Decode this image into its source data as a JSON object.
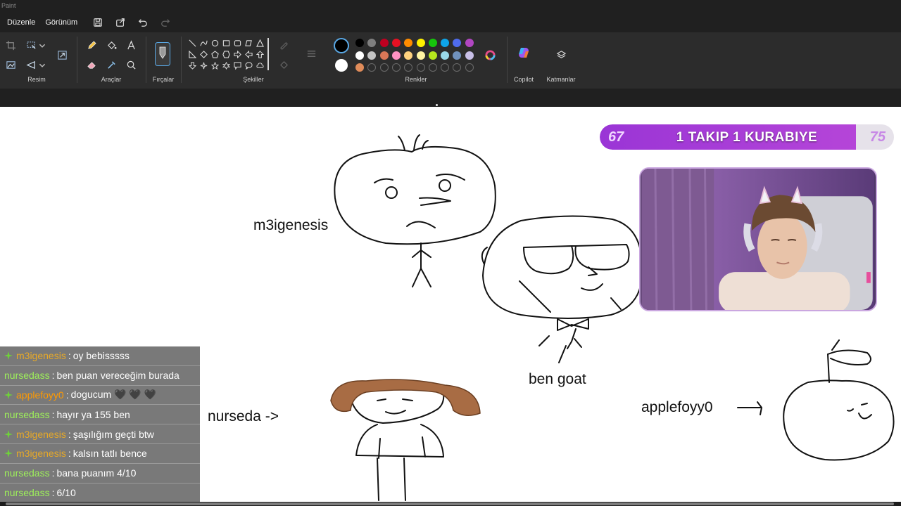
{
  "window": {
    "title": "Paint"
  },
  "menu": {
    "edit": "Düzenle",
    "view": "Görünüm"
  },
  "ribbon": {
    "groups": {
      "image": "Resim",
      "tools": "Araçlar",
      "brushes": "Fırçalar",
      "shapes": "Şekiller",
      "colors": "Renkler",
      "copilot": "Copilot",
      "layers": "Katmanlar"
    },
    "palette": {
      "row1": [
        "#000000",
        "#7f7f7f",
        "#c00020",
        "#e81123",
        "#ff8c00",
        "#fff100",
        "#16c60c",
        "#0ea5e9",
        "#4f6bed",
        "#b146c2"
      ],
      "row2": [
        "#ffffff",
        "#c3c3c3",
        "#d97757",
        "#ff92c2",
        "#ffd27f",
        "#fff4a3",
        "#b5e61d",
        "#99d9ea",
        "#7092be",
        "#c8bfe7"
      ],
      "row3": [
        "#e08c5a"
      ],
      "primary": "#000000",
      "secondary": "#ffffff"
    }
  },
  "goal": {
    "start": "67",
    "title": "1 TAKIP 1 KURABIYE",
    "end": "75",
    "progress": 0.87
  },
  "canvas": {
    "labels": {
      "m3igenesis": "m3igenesis",
      "ben_goat": "ben goat",
      "nurseda": "nurseda ->",
      "applefoyy": "applefoyy0"
    }
  },
  "chat": [
    {
      "user": "m3igenesis",
      "color": "#e7a928",
      "badge": true,
      "text": "oy bebisssss"
    },
    {
      "user": "nursedass",
      "color": "#9ef05a",
      "badge": false,
      "text": "ben puan vereceğim burada"
    },
    {
      "user": "applefoyy0",
      "color": "#ff9a00",
      "badge": true,
      "text": "dogucum 🖤 🖤 🖤"
    },
    {
      "user": "nursedass",
      "color": "#9ef05a",
      "badge": false,
      "text": "hayır ya 155 ben"
    },
    {
      "user": "m3igenesis",
      "color": "#e7a928",
      "badge": true,
      "text": "şaşılığım geçti btw"
    },
    {
      "user": "m3igenesis",
      "color": "#e7a928",
      "badge": true,
      "text": "kalsın tatlı bence"
    },
    {
      "user": "nursedass",
      "color": "#9ef05a",
      "badge": false,
      "text": "bana puanım 4/10"
    },
    {
      "user": "nursedass",
      "color": "#9ef05a",
      "badge": false,
      "text": "6/10"
    }
  ]
}
